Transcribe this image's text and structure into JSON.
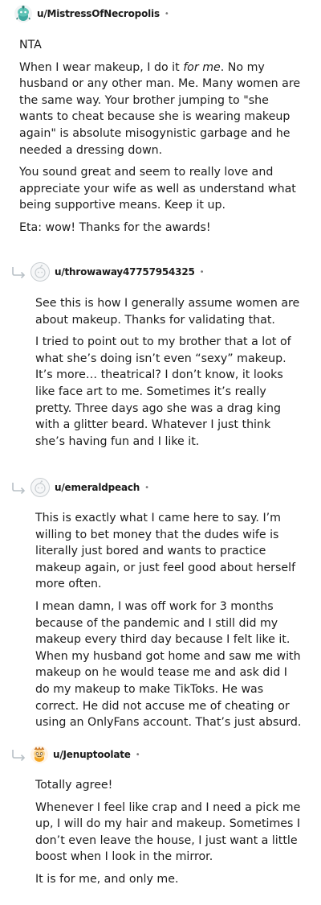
{
  "comments": [
    {
      "username": "u/MistressOfNecropolis",
      "paragraphs": [
        {
          "text": "NTA"
        },
        {
          "pre": "When I wear makeup, I do it ",
          "em": "for me",
          "post": ". No my husband or any other man. Me. Many women are the same way. Your brother jumping to \"she wants to cheat because she is wearing makeup again\" is absolute misogynistic garbage and he needed a dressing down."
        },
        {
          "text": "You sound great and seem to really love and appreciate your wife as well as understand what being supportive means. Keep it up."
        },
        {
          "text": "Eta: wow! Thanks for the awards!"
        }
      ]
    },
    {
      "username": "u/throwaway47757954325",
      "paragraphs": [
        {
          "text": "See this is how I generally assume women are about makeup. Thanks for validating that."
        },
        {
          "text": "I tried to point out to my brother that a lot of what she’s doing isn’t even “sexy” makeup. It’s more… theatrical? I don’t know, it looks like face art to me. Sometimes it’s really pretty. Three days ago she was a drag king with a glitter beard. Whatever I just think she’s having fun and I like it."
        }
      ]
    },
    {
      "username": "u/emeraldpeach",
      "paragraphs": [
        {
          "text": "This is exactly what I came here to say. I’m willing to bet money that the dudes wife is literally just bored and wants to practice makeup again, or just feel good about herself more often."
        },
        {
          "text": "I mean damn, I was off work for 3 months because of the pandemic and I still did my makeup every third day because I felt like it. When my husband got home and saw me with makeup on he would tease me and ask did I do my makeup to make TikToks. He was correct. He did not accuse me of cheating or using an OnlyFans account. That’s just absurd."
        }
      ]
    },
    {
      "username": "u/Jenuptoolate",
      "paragraphs": [
        {
          "text": "Totally agree!"
        },
        {
          "text": "Whenever I feel like crap and I need a pick me up, I will do my hair and makeup. Sometimes I don’t even leave the house, I just want a little boost when I look in the mirror."
        },
        {
          "text": "It is for me, and only me."
        }
      ]
    }
  ],
  "separator": "•",
  "icons": {
    "avatar_1": "snoo-avatar-teal-icon",
    "avatar_2": "default-avatar-icon",
    "avatar_3": "default-avatar-icon",
    "avatar_4": "snoo-avatar-orange-icon",
    "reply": "reply-arrow-icon"
  },
  "colors": {
    "text": "#1c1c1c",
    "meta": "#7c7c7c",
    "reply_arrow": "#b8c0c6"
  }
}
